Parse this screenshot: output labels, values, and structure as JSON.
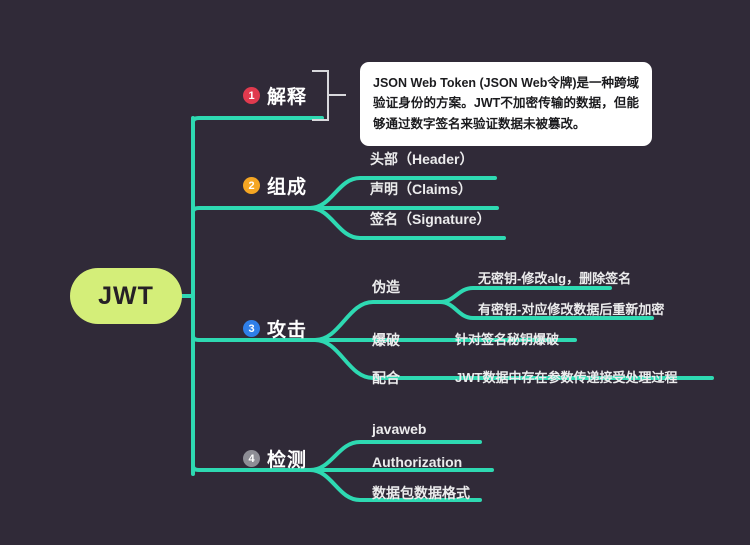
{
  "canvas": {
    "background_color": "#302a38",
    "branch_line_color": "#2ed9b2",
    "bracket_color": "#d8d8dc"
  },
  "root": {
    "label": "JWT",
    "fill_color": "#d4ee79",
    "text_color": "#262026"
  },
  "branches": [
    {
      "number": "1",
      "badge_color": "#e03a4e",
      "label": "解释",
      "children": [],
      "note": {
        "text": "JSON Web Token (JSON Web令牌)是一种跨域验证身份的方案。JWT不加密传输的数据，但能够通过数字签名来验证数据未被篡改。",
        "background_color": "#ffffff",
        "text_color": "#1b1b1e"
      }
    },
    {
      "number": "2",
      "badge_color": "#f5a623",
      "label": "组成",
      "children": [
        {
          "label": "头部（Header）",
          "children": []
        },
        {
          "label": "声明（Claims）",
          "children": []
        },
        {
          "label": "签名（Signature）",
          "children": []
        }
      ]
    },
    {
      "number": "3",
      "badge_color": "#2f7fe8",
      "label": "攻击",
      "children": [
        {
          "label": "伪造",
          "children": [
            {
              "label": "无密钥-修改alg，删除签名"
            },
            {
              "label": "有密钥-对应修改数据后重新加密"
            }
          ]
        },
        {
          "label": "爆破",
          "children": [
            {
              "label": "针对签名秘钥爆破"
            }
          ]
        },
        {
          "label": "配合",
          "children": [
            {
              "label": "JWT数据中存在参数传递接受处理过程"
            }
          ]
        }
      ]
    },
    {
      "number": "4",
      "badge_color": "#8d8d95",
      "label": "检测",
      "children": [
        {
          "label": "javaweb",
          "children": []
        },
        {
          "label": "Authorization",
          "children": []
        },
        {
          "label": "数据包数据格式",
          "children": []
        }
      ]
    }
  ]
}
